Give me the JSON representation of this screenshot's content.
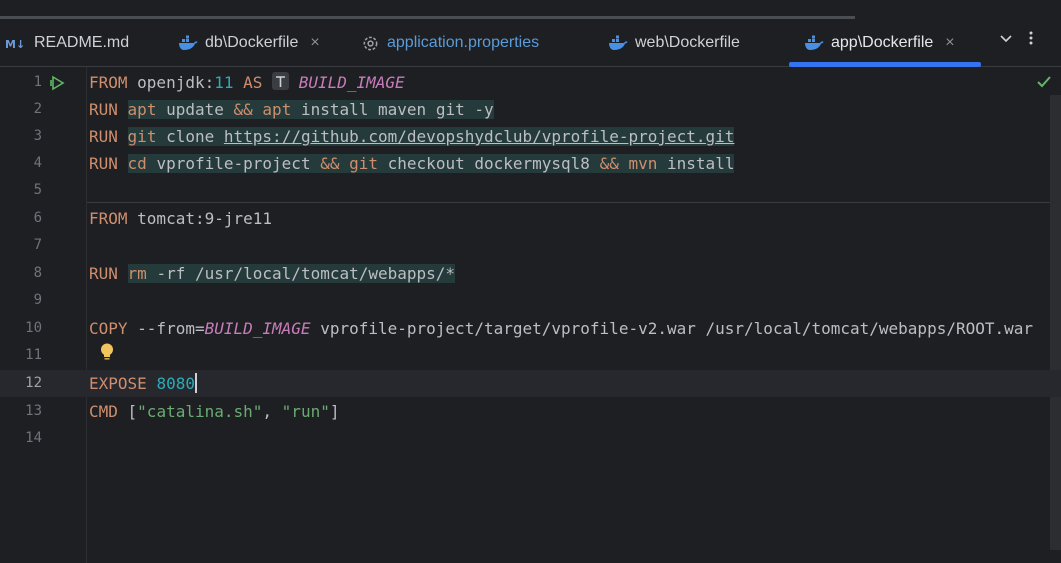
{
  "tabs": [
    {
      "label": "README.md",
      "icon": "markdown-icon"
    },
    {
      "label": "db\\Dockerfile",
      "icon": "docker-icon",
      "close": "×"
    },
    {
      "label": "application.properties",
      "icon": "gear-icon"
    },
    {
      "label": "web\\Dockerfile",
      "icon": "docker-icon"
    },
    {
      "label": "app\\Dockerfile",
      "icon": "docker-icon",
      "close": "×",
      "active": true
    }
  ],
  "tab_actions": {
    "more_tabs": "chevron-down-icon",
    "menu": "more-vertical-icon"
  },
  "code": {
    "line_numbers": [
      "1",
      "2",
      "3",
      "4",
      "5",
      "6",
      "7",
      "8",
      "9",
      "10",
      "11",
      "12",
      "13",
      "14"
    ],
    "l1": {
      "kw1": "FROM",
      "t1": " openjdk:",
      "num": "11",
      "t2": " ",
      "kw2": "AS",
      "t3": " ",
      "alias": "BUILD_IMAGE"
    },
    "l2": {
      "kw1": "RUN",
      "t1": " ",
      "cmd1": "apt",
      "t2": " update ",
      "op": "&&",
      "t3": " ",
      "cmd2": "apt",
      "t4": " install maven git -y"
    },
    "l3": {
      "kw1": "RUN",
      "t1": " ",
      "cmd1": "git",
      "t2": " clone ",
      "url": "https://github.com/devopshydclub/vprofile-project.git"
    },
    "l4": {
      "kw1": "RUN",
      "t1": " ",
      "cmd1": "cd",
      "t2": " vprofile-project ",
      "op1": "&&",
      "t3": " ",
      "cmd2": "git",
      "t4": " checkout dockermysql8 ",
      "op2": "&&",
      "t5": " ",
      "cmd3": "mvn",
      "t6": " install"
    },
    "l6": {
      "kw1": "FROM",
      "t1": " tomcat:9-jre11"
    },
    "l8": {
      "kw1": "RUN",
      "t1": " ",
      "cmd1": "rm",
      "t2": " -rf /usr/local/tomcat/webapps/*"
    },
    "l10": {
      "kw1": "COPY",
      "t1": " --from=",
      "alias": "BUILD_IMAGE",
      "t2": " vprofile-project/target/vprofile-v2.war /usr/local/tomcat/webapps/ROOT.war"
    },
    "l12": {
      "kw1": "EXPOSE",
      "t1": " ",
      "num": "8080"
    },
    "l13": {
      "kw1": "CMD",
      "t1": " [",
      "s1": "\"catalina.sh\"",
      "t2": ", ",
      "s2": "\"run\"",
      "t3": "]"
    }
  },
  "status": {
    "inspection": "checkmark-icon"
  },
  "colors": {
    "accent": "#3574f0",
    "keyword": "#cf8e6d",
    "number": "#2aacb8",
    "string": "#6aab73",
    "alias": "#c77dbb"
  }
}
